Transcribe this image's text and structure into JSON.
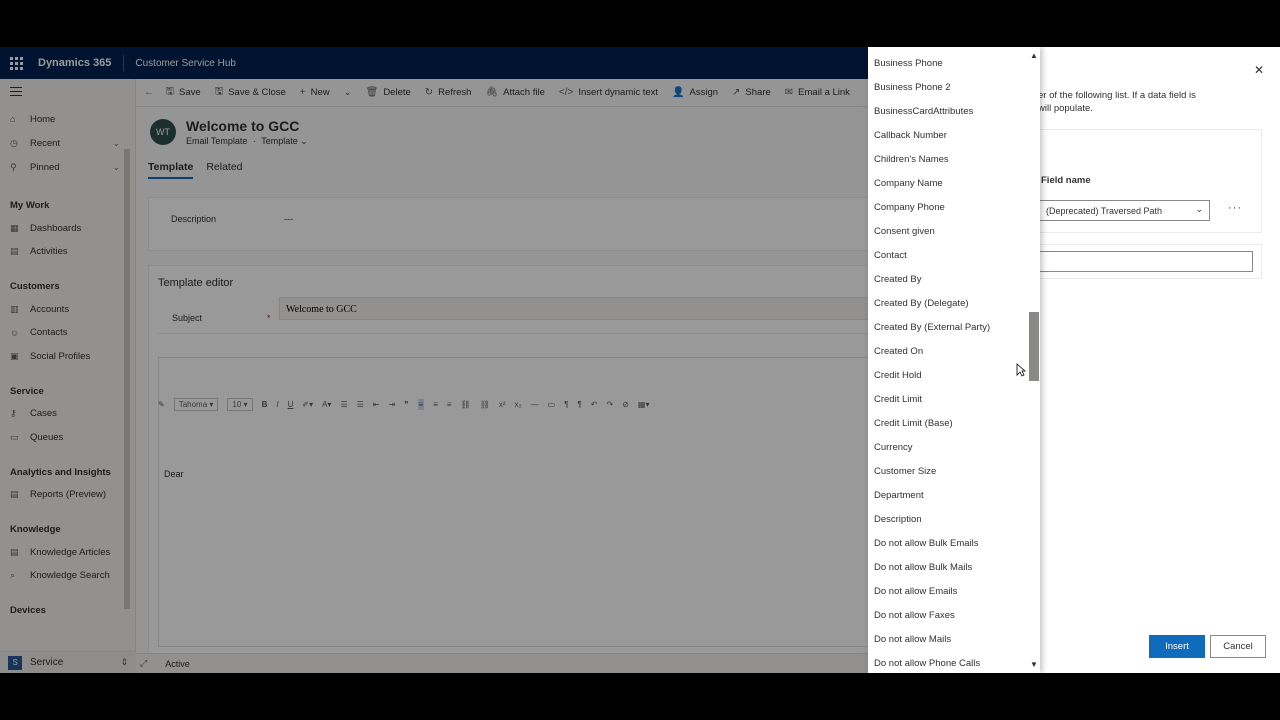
{
  "topbar": {
    "app_name": "Dynamics 365",
    "hub_name": "Customer Service Hub"
  },
  "sidebar": {
    "items": [
      {
        "label": "Home",
        "icon": "home-icon",
        "glyph": "⌂"
      },
      {
        "label": "Recent",
        "icon": "clock-icon",
        "glyph": "◷",
        "chevron": "⌄"
      },
      {
        "label": "Pinned",
        "icon": "pin-icon",
        "glyph": "⚲",
        "chevron": "⌄"
      }
    ],
    "groups": [
      {
        "title": "My Work",
        "items": [
          {
            "label": "Dashboards",
            "glyph": "▦"
          },
          {
            "label": "Activities",
            "glyph": "▤"
          }
        ]
      },
      {
        "title": "Customers",
        "items": [
          {
            "label": "Accounts",
            "glyph": "▥"
          },
          {
            "label": "Contacts",
            "glyph": "☺"
          },
          {
            "label": "Social Profiles",
            "glyph": "▣"
          }
        ]
      },
      {
        "title": "Service",
        "items": [
          {
            "label": "Cases",
            "glyph": "⚷"
          },
          {
            "label": "Queues",
            "glyph": "▭"
          }
        ]
      },
      {
        "title": "Analytics and Insights",
        "items": [
          {
            "label": "Reports (Preview)",
            "glyph": "▤"
          }
        ]
      },
      {
        "title": "Knowledge",
        "items": [
          {
            "label": "Knowledge Articles",
            "glyph": "▤"
          },
          {
            "label": "Knowledge Search",
            "glyph": "⌕"
          }
        ]
      },
      {
        "title": "Devices",
        "items": []
      }
    ],
    "area": {
      "badge": "S",
      "label": "Service"
    }
  },
  "commands": [
    "Save",
    "Save & Close",
    "New",
    "Delete",
    "Refresh",
    "Attach file",
    "Insert dynamic text",
    "Assign",
    "Share",
    "Email a Link"
  ],
  "command_glyphs": [
    "🖫",
    "🖫",
    "+",
    "🗑",
    "↻",
    "🖇",
    "</>",
    "👤",
    "↗",
    "✉"
  ],
  "record": {
    "avatar": "WT",
    "title": "Welcome to GCC",
    "entity": "Email Template",
    "separator": "·",
    "form": "Template"
  },
  "tabs": [
    "Template",
    "Related"
  ],
  "form": {
    "description_label": "Description",
    "description_value": "---",
    "editor_title": "Template editor",
    "subject_label": "Subject",
    "subject_required": "*",
    "subject_value": "Welcome to GCC",
    "font_name": "Tahoma",
    "font_size": "10",
    "body_text": "Dear"
  },
  "status": {
    "state": "Active"
  },
  "dialog": {
    "description_line1": "er of the following list. If a data field is",
    "description_line2": "will populate.",
    "field_name_label": "Field name",
    "field_value": "(Deprecated) Traversed Path",
    "more": "···",
    "insert_label": "Insert",
    "cancel_label": "Cancel",
    "close_glyph": "✕"
  },
  "dropdown": {
    "options": [
      "Business Phone",
      "Business Phone 2",
      "BusinessCardAttributes",
      "Callback Number",
      "Children's Names",
      "Company Name",
      "Company Phone",
      "Consent given",
      "Contact",
      "Created By",
      "Created By (Delegate)",
      "Created By (External Party)",
      "Created On",
      "Credit Hold",
      "Credit Limit",
      "Credit Limit (Base)",
      "Currency",
      "Customer Size",
      "Department",
      "Description",
      "Do not allow Bulk Emails",
      "Do not allow Bulk Mails",
      "Do not allow Emails",
      "Do not allow Faxes",
      "Do not allow Mails",
      "Do not allow Phone Calls"
    ],
    "scroll_position": 0.42
  },
  "colors": {
    "nav_bg": "#002050",
    "accent": "#0f6cbd"
  }
}
